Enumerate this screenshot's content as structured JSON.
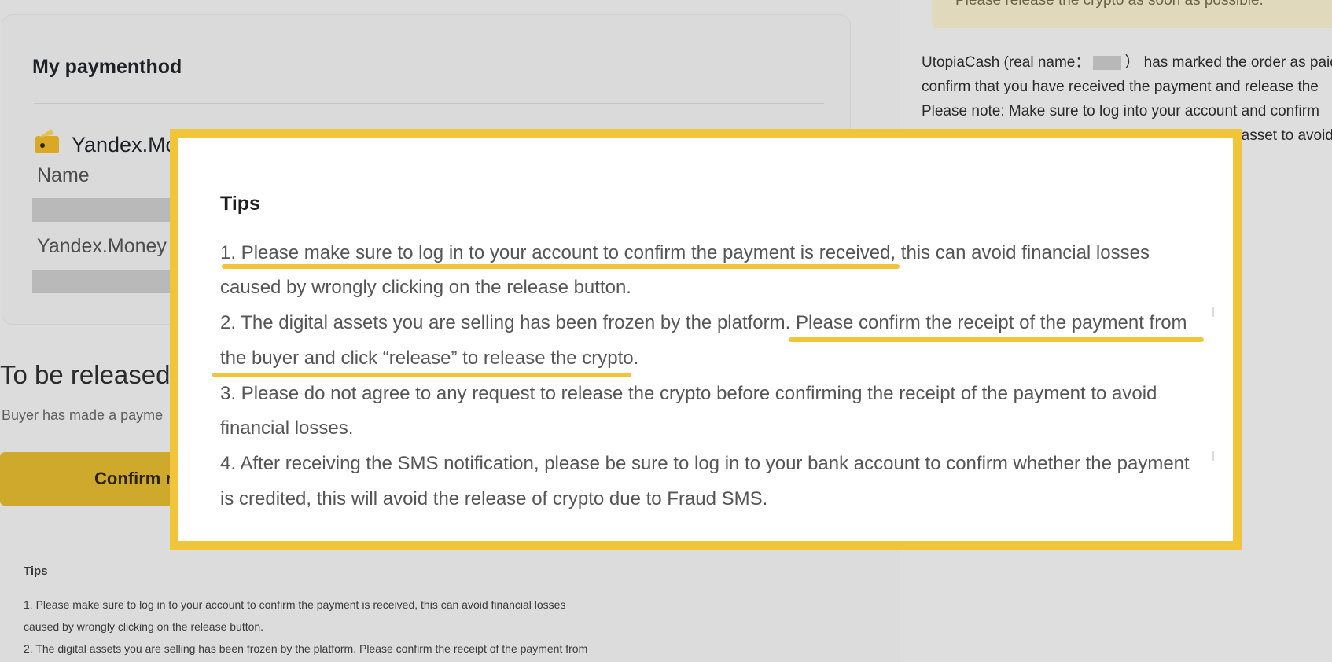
{
  "background": {
    "payment_card": {
      "title": "My paymenthod",
      "method_name": "Yandex.Money",
      "field_name_label": "Name",
      "field_account_label": "Yandex.Money"
    },
    "release": {
      "title": "To be released",
      "subtitle": "Buyer has made a payme",
      "confirm_label": "Confirm r"
    },
    "notice_strip": "Please release the crypto as soon as possible.",
    "right_panel": {
      "line1_pre": "UtopiaCash (real name：",
      "line1_post": "） has marked the order as paid",
      "line2": "confirm that you have received the payment and release the",
      "line3": "Please note: Make sure to log into your account and confirm",
      "line4": "have received the payment before releasing the asset to avoid"
    },
    "small_tips": {
      "title": "Tips",
      "lines": [
        "1. Please make sure to log in to your account to confirm the payment is received, this can avoid financial losses",
        "caused by wrongly clicking on the release button.",
        "2. The digital assets you are selling has been frozen by the platform. Please confirm the receipt of the payment from"
      ]
    }
  },
  "zoom": {
    "title": "Tips",
    "lines": [
      "1. Please make sure to log in to your account to confirm the payment is received, this can avoid financial losses",
      "caused by wrongly clicking on the release button.",
      "2. The digital assets you are selling has been frozen by the platform. Please confirm the receipt of the payment from",
      "the buyer and click “release” to release the crypto.",
      "3. Please do not agree to any request to release the crypto before confirming the receipt of the payment to avoid",
      "financial losses.",
      "4. After receiving the SMS notification, please be sure to log in to your bank account to confirm whether the payment",
      "is credited, this will avoid the release of crypto due to Fraud SMS."
    ]
  },
  "colors": {
    "highlight": "#f0c53a",
    "button": "#cfa92c"
  },
  "icons": {
    "wallet": "yandex-wallet-icon"
  }
}
